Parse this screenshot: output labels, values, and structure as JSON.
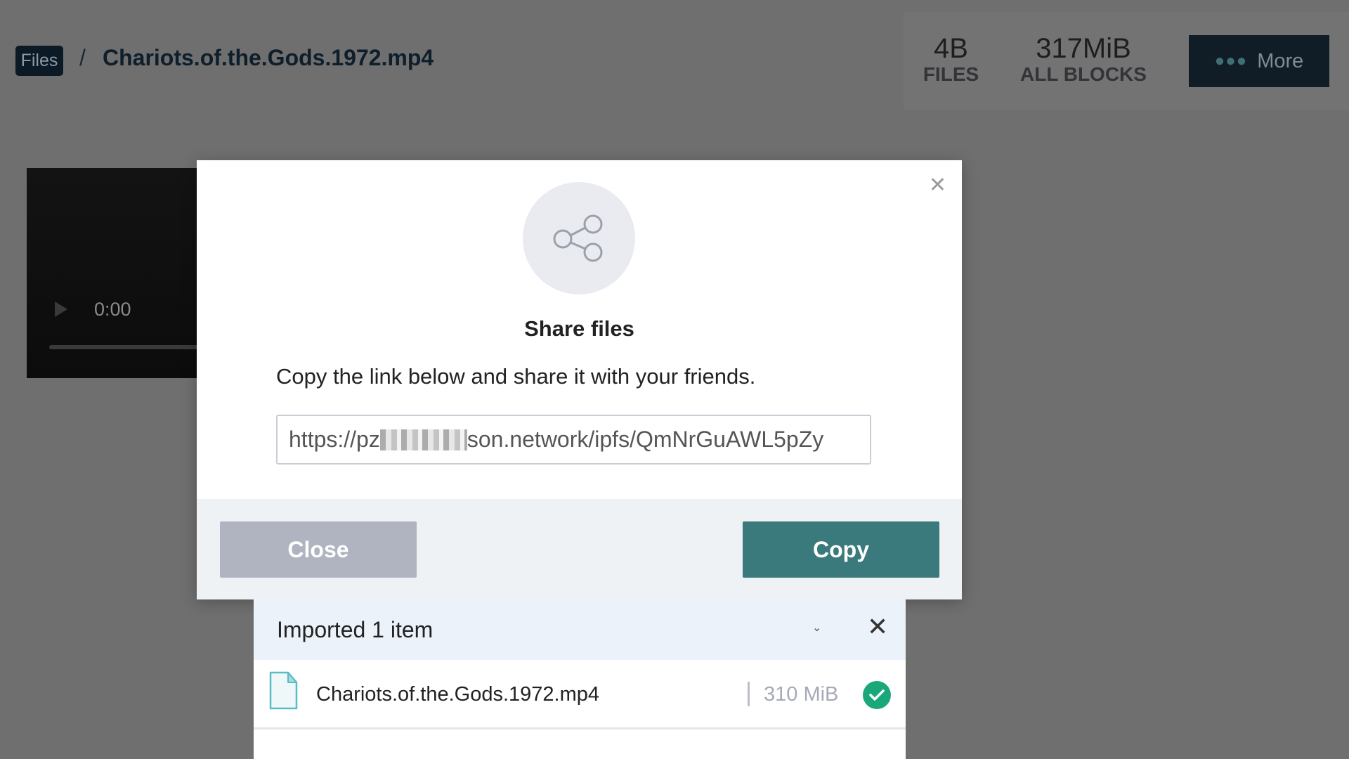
{
  "breadcrumb": {
    "root": "Files",
    "separator": "/",
    "current": "Chariots.of.the.Gods.1972.mp4"
  },
  "stats": [
    {
      "value": "4B",
      "label": "FILES"
    },
    {
      "value": "317MiB",
      "label": "ALL BLOCKS"
    }
  ],
  "more_button": {
    "icon": "dots-icon",
    "label": "More"
  },
  "video": {
    "time": "0:00"
  },
  "modal": {
    "icon": "share-icon",
    "title": "Share files",
    "description": "Copy the link below and share it with your friends.",
    "link_prefix": "https://pz",
    "link_suffix": "son.network/ipfs/QmNrGuAWL5pZy",
    "close_label": "Close",
    "copy_label": "Copy"
  },
  "import_panel": {
    "title": "Imported 1 item",
    "items": [
      {
        "name": "Chariots.of.the.Gods.1972.mp4",
        "size": "310 MiB",
        "status": "complete"
      }
    ]
  },
  "colors": {
    "accent": "#3b7a7c",
    "success": "#1aa87b",
    "close_button": "#b0b4c1"
  }
}
